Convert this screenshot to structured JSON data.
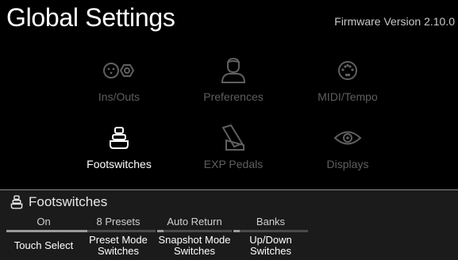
{
  "header": {
    "title": "Global Settings",
    "firmware": "Firmware Version 2.10.0"
  },
  "menu": {
    "items": [
      {
        "id": "ins-outs",
        "label": "Ins/Outs",
        "icon": "ins-outs-icon",
        "active": false
      },
      {
        "id": "preferences",
        "label": "Preferences",
        "icon": "preferences-icon",
        "active": false
      },
      {
        "id": "midi-tempo",
        "label": "MIDI/Tempo",
        "icon": "midi-tempo-icon",
        "active": false
      },
      {
        "id": "footswitches",
        "label": "Footswitches",
        "icon": "footswitches-icon",
        "active": true
      },
      {
        "id": "exp-pedals",
        "label": "EXP Pedals",
        "icon": "exp-pedal-icon",
        "active": false
      },
      {
        "id": "displays",
        "label": "Displays",
        "icon": "displays-icon",
        "active": false
      }
    ]
  },
  "panel": {
    "title": "Footswitches",
    "icon": "footswitch-icon",
    "params": [
      {
        "value": "On",
        "name": "Touch Select",
        "level": 1.0
      },
      {
        "value": "8 Presets",
        "name": "Preset Mode Switches",
        "level": 0.08
      },
      {
        "value": "Auto Return",
        "name": "Snapshot Mode Switches",
        "level": 0.08
      },
      {
        "value": "Banks",
        "name": "Up/Down Switches",
        "level": 0.08
      }
    ]
  },
  "colors": {
    "background": "#000000",
    "panel_background": "#1b1b1b",
    "inactive_label": "#5f5f5f",
    "active_label": "#ffffff"
  }
}
